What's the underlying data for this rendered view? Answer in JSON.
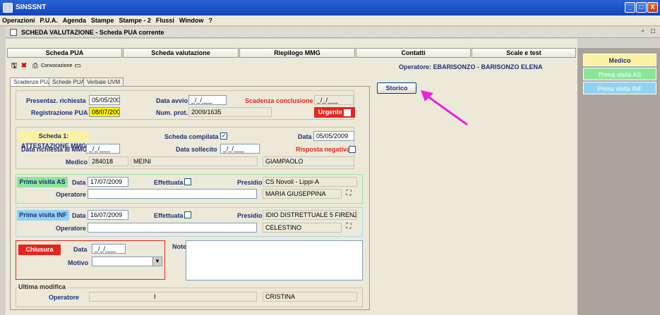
{
  "window": {
    "title": "SINSSNT",
    "controls": [
      "_",
      "□",
      "X"
    ]
  },
  "menu": [
    "Operazioni",
    "P.U.A.",
    "Agenda",
    "Stampe",
    "Stampe - 2",
    "Flussi",
    "Window",
    "?"
  ],
  "sheet": {
    "title": "SCHEDA VALUTAZIONE - Scheda PUA corrente"
  },
  "top_tabs": [
    "Scheda PUA",
    "Scheda valutazione",
    "Riepilogo MMG",
    "Contatti",
    "Scale e test"
  ],
  "toolbar": {
    "convocazione": "Convocazione"
  },
  "operator": "Operatore: EBARISONZO - BARISONZO ELENA",
  "side": {
    "medico": "Medico",
    "prima_visita_as": "Prima visita AS",
    "prima_visita_inf": "Prima visita INF"
  },
  "inner_tabs": [
    "Scadenze PUA",
    "Schede PUA",
    "Verbale UVM"
  ],
  "storico": "Storico",
  "top": {
    "presentaz_label": "Presentaz. richiesta",
    "presentaz_value": "05/05/2009",
    "data_avvio_label": "Data avvio",
    "data_avvio_value": "_/_/___",
    "scadenza_label": "Scadenza conclusione",
    "scadenza_value": "_/_/___",
    "registrazione_label": "Registrazione PUA",
    "registrazione_value": "08/07/2009",
    "num_prot_label": "Num. prot.",
    "num_prot_value": "2009/1635",
    "urgente": "Urgente"
  },
  "scheda1": {
    "badge": "Scheda 1: ATTESTAZIONE MMG",
    "compilata_label": "Scheda compilata",
    "data_label": "Data",
    "data_value": "05/05/2009",
    "richiesta_label": "Data richiesta al MMG",
    "richiesta_value": "_/_/___",
    "sollecito_label": "Data sollecito",
    "sollecito_value": "_/_/___",
    "risposta_label": "Risposta negativa",
    "medico_label": "Medico",
    "medico_code": "284018",
    "medico_surname": "MEINI",
    "medico_name": "GIAMPAOLO"
  },
  "visita_as": {
    "badge": "Prima visita AS",
    "data_label": "Data",
    "data_value": "17/07/2009",
    "effettuata_label": "Effettuata",
    "presidio_label": "Presidio",
    "presidio_value": "CS Novoli - Lippi-A",
    "operatore_label": "Operatore",
    "operatore_value": "MARIA GIUSEPPINA"
  },
  "visita_inf": {
    "badge": "Prima visita INF",
    "data_label": "Data",
    "data_value": "16/07/2009",
    "effettuata_label": "Effettuata",
    "presidio_label": "Presidio",
    "presidio_value": "IDIO DISTRETTUALE 5 FIRENZE",
    "operatore_label": "Operatore",
    "operatore_value": "CELESTINO"
  },
  "chiusura": {
    "badge": "Chiusura",
    "data_label": "Data",
    "data_value": "_/_/___",
    "motivo_label": "Motivo",
    "note_label": "Note"
  },
  "ultima": {
    "title": "Ultima modifica",
    "operatore_label": "Operatore",
    "operatore_value": "I",
    "operatore_name": "CRISTINA"
  },
  "colors": {
    "accent_blue": "#1f2f7a",
    "red": "#e8241f",
    "yellow": "#fff000",
    "medico": "#fbf3a2",
    "side_as": "#8ce69a",
    "side_inf": "#8fd3f0"
  }
}
